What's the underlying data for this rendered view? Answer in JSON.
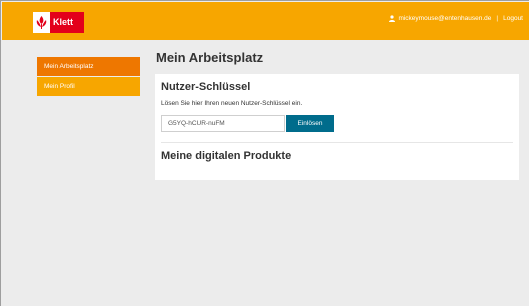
{
  "header": {
    "logo_text": "Klett",
    "user_email": "mickeymouse@entenhausen.de",
    "separator": "|",
    "logout_label": "Logout"
  },
  "sidebar": {
    "items": [
      {
        "label": "Mein Arbeitsplatz",
        "active": true
      },
      {
        "label": "Mein Profil",
        "active": false
      }
    ]
  },
  "main": {
    "title": "Mein Arbeitsplatz",
    "key_section": {
      "title": "Nutzer-Schlüssel",
      "hint": "Lösen Sie hier Ihren neuen Nutzer-Schlüssel ein.",
      "input_value": "G5YQ-hCUR-nuFM",
      "button_label": "Einlösen"
    },
    "products_section": {
      "title": "Meine digitalen Produkte"
    }
  },
  "colors": {
    "brand_orange": "#f7a600",
    "active_nav": "#ee7700",
    "logo_red": "#e3001b",
    "button_blue": "#006c8c"
  }
}
